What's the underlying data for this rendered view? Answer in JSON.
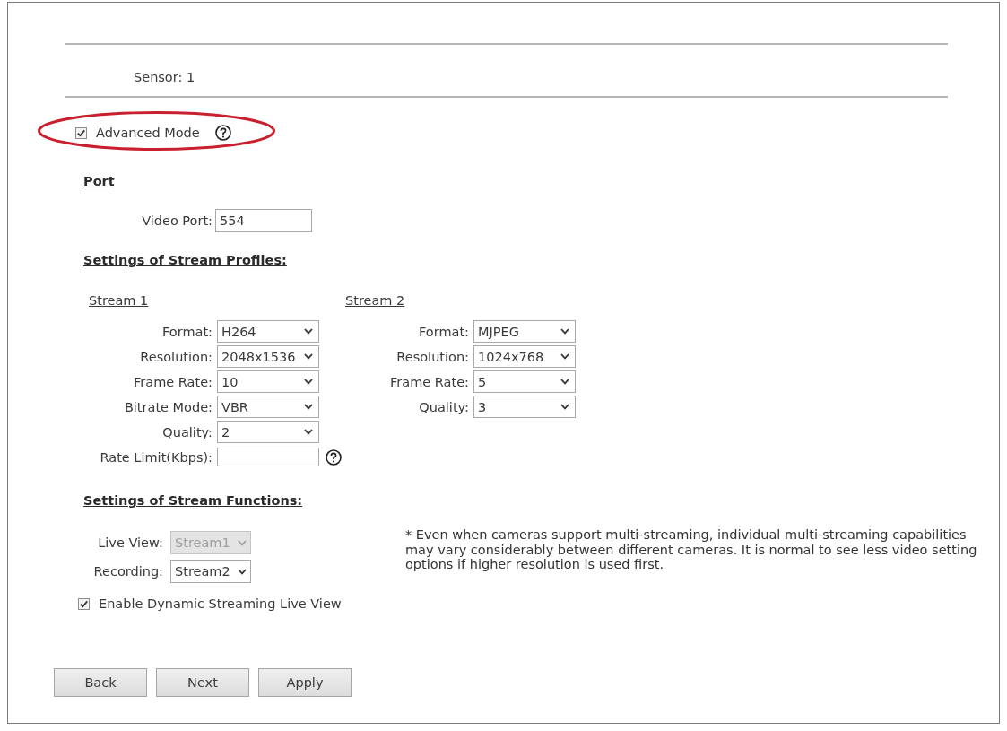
{
  "sensor": {
    "text": "Sensor: 1"
  },
  "advanced_mode": {
    "label": "Advanced Mode",
    "checked": true,
    "help": true,
    "highlighted": true
  },
  "port": {
    "heading": "Port",
    "fields": [
      {
        "label": "Video Port:",
        "value": "554"
      }
    ]
  },
  "stream_profiles": {
    "heading": "Settings of Stream Profiles:",
    "streams": [
      {
        "title": "Stream 1",
        "settings": [
          {
            "kind": "select",
            "label": "Format:",
            "value": "H264"
          },
          {
            "kind": "select",
            "label": "Resolution:",
            "value": "2048x1536"
          },
          {
            "kind": "select",
            "label": "Frame Rate:",
            "value": "10"
          },
          {
            "kind": "select",
            "label": "Bitrate Mode:",
            "value": "VBR"
          },
          {
            "kind": "select",
            "label": "Quality:",
            "value": "2"
          },
          {
            "kind": "input",
            "label": "Rate Limit(Kbps):",
            "help": true
          }
        ]
      },
      {
        "title": "Stream 2",
        "settings": [
          {
            "kind": "select",
            "label": "Format:",
            "value": "MJPEG"
          },
          {
            "kind": "select",
            "label": "Resolution:",
            "value": "1024x768"
          },
          {
            "kind": "select",
            "label": "Frame Rate:",
            "value": "5"
          },
          {
            "kind": "select",
            "label": "Quality:",
            "value": "3"
          }
        ]
      }
    ]
  },
  "stream_functions": {
    "heading": "Settings of Stream Functions:",
    "settings": [
      {
        "label": "Live View:",
        "value": "Stream1",
        "disabled": true
      },
      {
        "label": "Recording:",
        "value": "Stream2",
        "disabled": false
      }
    ],
    "dynamic_live_view": {
      "label": "Enable Dynamic Streaming Live View",
      "checked": true
    },
    "note": "* Even when cameras support multi-streaming, individual multi-streaming capabilities may vary considerably between different cameras. It is normal to see less video setting options if higher resolution is used first."
  },
  "buttons": [
    "Back",
    "Next",
    "Apply"
  ]
}
